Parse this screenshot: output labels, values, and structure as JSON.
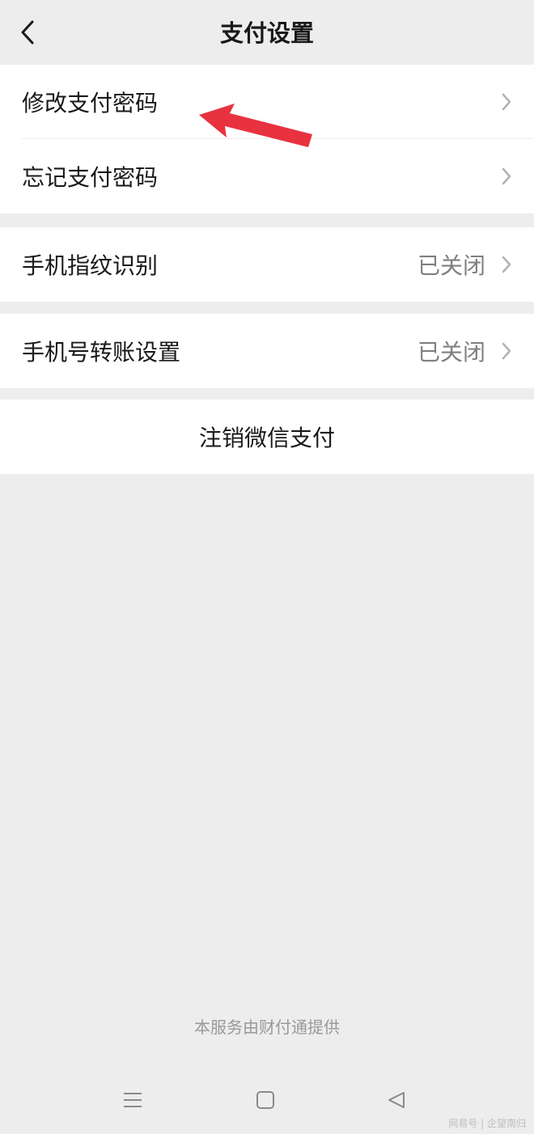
{
  "header": {
    "title": "支付设置",
    "back_icon": "chevron-left-icon"
  },
  "groups": {
    "password": {
      "items": [
        {
          "label": "修改支付密码",
          "icon": "chevron-right-icon"
        },
        {
          "label": "忘记支付密码",
          "icon": "chevron-right-icon"
        }
      ]
    },
    "fingerprint": {
      "label": "手机指纹识别",
      "value": "已关闭",
      "icon": "chevron-right-icon"
    },
    "phone_transfer": {
      "label": "手机号转账设置",
      "value": "已关闭",
      "icon": "chevron-right-icon"
    },
    "deregister": {
      "label": "注销微信支付"
    }
  },
  "footer": {
    "note": "本服务由财付通提供"
  },
  "system_nav": {
    "menu_icon": "menu-icon",
    "home_icon": "home-square-icon",
    "back_icon": "back-triangle-icon"
  },
  "annotation": {
    "arrow_color": "#e8323f"
  },
  "watermark": {
    "text": "网易号 | 企望南归"
  },
  "colors": {
    "background": "#ededed",
    "card": "#ffffff",
    "text": "#191919",
    "secondary_text": "#7f7f7f",
    "chevron": "#b2b2b2"
  }
}
